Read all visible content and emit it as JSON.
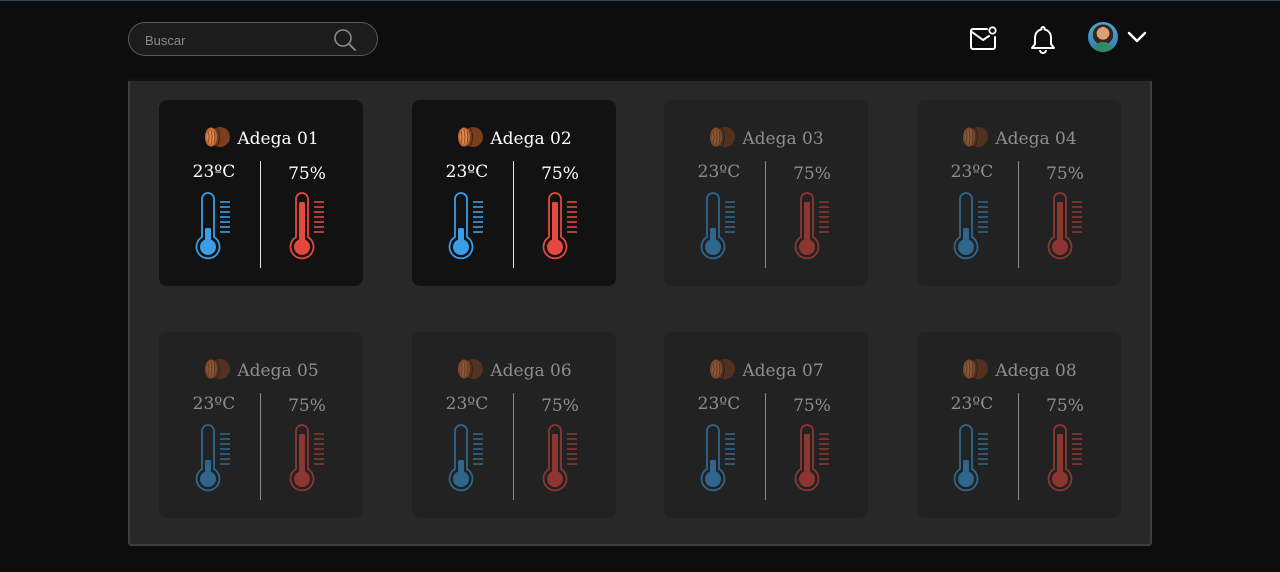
{
  "search": {
    "placeholder": "Buscar"
  },
  "colors": {
    "cold": "#3a9ee6",
    "hot": "#e4483e",
    "background": "#0d0d0d",
    "panel": "#282828"
  },
  "cellars": [
    {
      "name": "Adega 01",
      "temperature": "23ºC",
      "humidity": "75%",
      "active": true
    },
    {
      "name": "Adega 02",
      "temperature": "23ºC",
      "humidity": "75%",
      "active": true
    },
    {
      "name": "Adega 03",
      "temperature": "23ºC",
      "humidity": "75%",
      "active": false
    },
    {
      "name": "Adega 04",
      "temperature": "23ºC",
      "humidity": "75%",
      "active": false
    },
    {
      "name": "Adega 05",
      "temperature": "23ºC",
      "humidity": "75%",
      "active": false
    },
    {
      "name": "Adega 06",
      "temperature": "23ºC",
      "humidity": "75%",
      "active": false
    },
    {
      "name": "Adega 07",
      "temperature": "23ºC",
      "humidity": "75%",
      "active": false
    },
    {
      "name": "Adega 08",
      "temperature": "23ºC",
      "humidity": "75%",
      "active": false
    }
  ]
}
